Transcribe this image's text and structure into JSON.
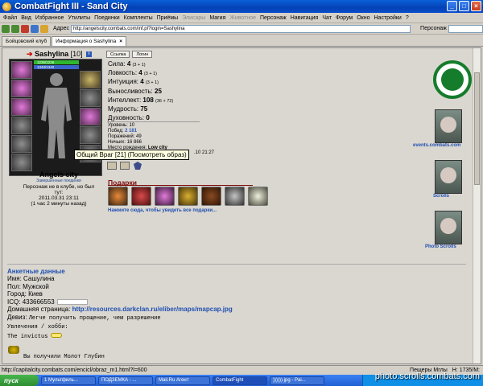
{
  "window": {
    "title": "CombatFight III - Sand City"
  },
  "menu": {
    "items": [
      "Файл",
      "Вид",
      "Избранное",
      "Утилиты",
      "Поединки",
      "Комплекты",
      "Приёмы",
      "Элисары",
      "Магия",
      "Животное",
      "Персонаж",
      "Навигация",
      "Чат",
      "Форум",
      "Окно",
      "Настройки",
      "?"
    ],
    "disabled": [
      "Элисары",
      "Животное"
    ]
  },
  "address": {
    "label": "Адрес",
    "value": "http://angelscity.combats.com/inf.pl?login=Sashylina",
    "person_label": "Персонаж"
  },
  "tabs": [
    {
      "label": "Бойцовский клуб",
      "active": false
    },
    {
      "label": "Информация о Sashylina",
      "active": true
    }
  ],
  "character": {
    "arrow": "➔",
    "name": "Sashylina",
    "level": "[10]",
    "info_badge": "i",
    "hp_text": "1236/1236",
    "mp_text": "1340/1340",
    "hint": "Общий Враг [21] (Посмотреть образ)",
    "clan": "Angels city",
    "clan_sub": "Завершенные поединки",
    "absence": "Персонаж не в клубе, но был тут:",
    "absence_date": "2011.03.31 23:11",
    "absence_ago": "(1 час 2 минуты назад)"
  },
  "buttons": {
    "b1": "Ссылка",
    "b2": "Логин"
  },
  "stats": [
    {
      "label": "Сила:",
      "value": "4",
      "bonus": "(3 + 1)"
    },
    {
      "label": "Ловкость:",
      "value": "4",
      "bonus": "(3 + 1)"
    },
    {
      "label": "Интуиция:",
      "value": "4",
      "bonus": "(3 + 1)"
    },
    {
      "label": "Выносливость:",
      "value": "25",
      "bonus": ""
    },
    {
      "label": "Интеллект:",
      "value": "108",
      "bonus": "(36 + 72)"
    },
    {
      "label": "Мудрость:",
      "value": "75",
      "bonus": ""
    },
    {
      "label": "Духовность:",
      "value": "0",
      "bonus": ""
    }
  ],
  "record": {
    "level_label": "Уровень:",
    "level": "10",
    "wins_label": "Побед:",
    "wins": "2 181",
    "losses_label": "Поражений:",
    "losses": "49",
    "draws_label": "Ничьих:",
    "draws": "16 866",
    "birth_label": "Место рождения:",
    "birth": "Low city",
    "time": ".10 21:27"
  },
  "gifts": {
    "title": "Подарки",
    "link": "Нажмите сюда, чтобы увидеть все подарки..."
  },
  "right": {
    "l1": "events.combats.com",
    "l2": "Scrolls",
    "l3": "Photo Scrolls"
  },
  "about": {
    "title": "Анкетные данные",
    "name_label": "Имя:",
    "name": "Сашулина",
    "sex_label": "Пол:",
    "sex": "Мужской",
    "city_label": "Город:",
    "city": "Киев",
    "icq_label": "ICQ:",
    "icq": "433666553",
    "home_label": "Домашняя страница:",
    "home": "http://resources.darkclan.ru/eliber/maps/mapcap.jpg",
    "motto_label": "Девиз:",
    "motto": "Легче получить прощение, чем разрешение",
    "hobby_label": "Увлечения / хобби:",
    "hobby": "The invictus",
    "hammer": "Вы получили Молот Глубин"
  },
  "status": {
    "url": "http://capitalcity.combats.com/encicl/obraz_m1.html?l=600",
    "location": "Пещеры Мглы",
    "coord": "H: 1735/M:"
  },
  "taskbar": {
    "start": "пуск",
    "tasks": [
      "1 Мультфиль...",
      "ПОДЗЕМКА - ...",
      "Mail.Ru Агент",
      "CombatFight",
      ")))))).jpg - Pai..."
    ]
  },
  "watermark": "photo.scrolls.combats.com",
  "colors": {
    "link": "#1f4fb0",
    "gifts": "#7a0a0a",
    "titlebar": "#0a5fd8",
    "logo": "#157c2b"
  }
}
